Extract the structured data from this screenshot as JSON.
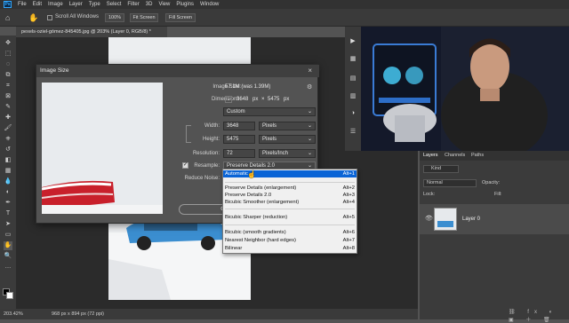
{
  "menubar": {
    "logo": "Ps",
    "items": [
      "File",
      "Edit",
      "Image",
      "Layer",
      "Type",
      "Select",
      "Filter",
      "3D",
      "View",
      "Plugins",
      "Window"
    ]
  },
  "options": {
    "scroll_all": "Scroll All Windows",
    "zoom": "100%",
    "fit_screen": "Fit Screen",
    "fill_screen": "Fill Screen"
  },
  "document": {
    "tab_title": "pexels-oziel-gómez-845405.jpg @ 203% (Layer 0, RGB/8) *",
    "zoom": "203.42%",
    "info": "968 px x 894 px (72 ppi)"
  },
  "dialog": {
    "title": "Image Size",
    "image_size_label": "Image Size:",
    "image_size_value": "57.1M (was 1.39M)",
    "dimensions_label": "Dimensions:",
    "dim_w": "3648",
    "dim_px1": "px",
    "dim_x": "×",
    "dim_h": "5475",
    "dim_px2": "px",
    "fit_to_label": "Fit To:",
    "fit_to_value": "Custom",
    "width_label": "Width:",
    "width_value": "3648",
    "width_unit": "Pixels",
    "height_label": "Height:",
    "height_value": "5475",
    "height_unit": "Pixels",
    "resolution_label": "Resolution:",
    "resolution_value": "72",
    "resolution_unit": "Pixels/Inch",
    "resample_label": "Resample:",
    "resample_value": "Preserve Details 2.0",
    "reduce_noise_label": "Reduce Noise:",
    "ok": "OK"
  },
  "resample_menu": [
    {
      "label": "Automatic",
      "key": "Alt+1",
      "selected": true
    },
    {
      "label": "Preserve Details (enlargement)",
      "key": "Alt+2"
    },
    {
      "label": "Preserve Details 2.0",
      "key": "Alt+3"
    },
    {
      "label": "Bicubic Smoother (enlargement)",
      "key": "Alt+4"
    },
    {
      "label": "Bicubic Sharper (reduction)",
      "key": "Alt+5"
    },
    {
      "label": "Bicubic (smooth gradients)",
      "key": "Alt+6"
    },
    {
      "label": "Nearest Neighbor (hard edges)",
      "key": "Alt+7"
    },
    {
      "label": "Bilinear",
      "key": "Alt+8"
    }
  ],
  "layers": {
    "tabs": [
      "Layers",
      "Channels",
      "Paths"
    ],
    "kind": "Kind",
    "mode": "Normal",
    "opacity_label": "Opacity:",
    "lock_label": "Lock:",
    "fill_label": "Fill:",
    "layer_name": "Layer 0"
  },
  "colors": {
    "accent_blue": "#31a8ff",
    "menu_highlight": "#0a64d6",
    "car_blue": "#3b8ed0",
    "car_red": "#c8202b"
  }
}
